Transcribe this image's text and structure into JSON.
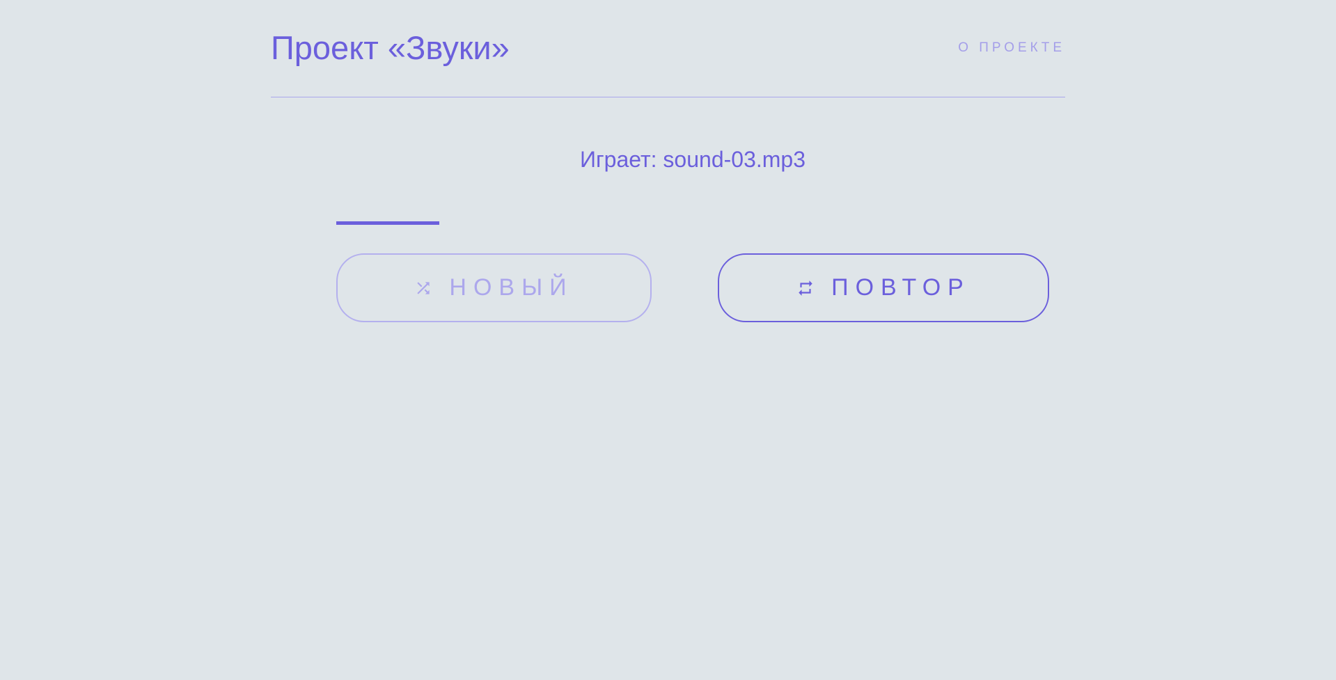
{
  "header": {
    "title": "Проект «Звуки»",
    "about_link": "О ПРОЕКТЕ"
  },
  "player": {
    "now_playing": "Играет: sound-03.mp3",
    "progress_fraction": 0.145
  },
  "buttons": {
    "new": {
      "label": "НОВЫЙ",
      "icon": "shuffle-icon",
      "state": "disabled"
    },
    "repeat": {
      "label": "ПОВТОР",
      "icon": "repeat-icon",
      "state": "enabled"
    }
  },
  "colors": {
    "accent": "#6b5fdc",
    "accent_muted": "#a49ee9",
    "background": "#dfe5e9"
  }
}
